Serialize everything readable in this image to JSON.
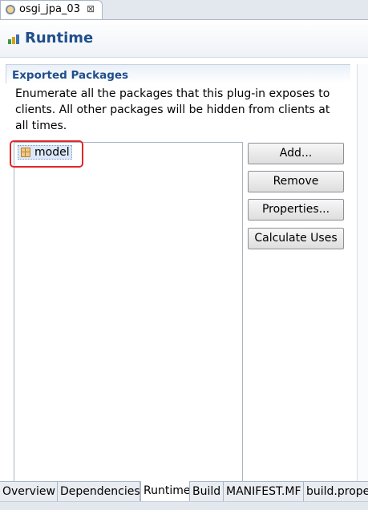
{
  "editor": {
    "tab_title": "osgi_jpa_03",
    "close_glyph": "⊠"
  },
  "page": {
    "title": "Runtime"
  },
  "section": {
    "title": "Exported Packages",
    "description": "Enumerate all the packages that this plug-in exposes to clients.  All other packages will be hidden from clients at all times."
  },
  "packages": [
    "model"
  ],
  "buttons": {
    "add": "Add...",
    "remove": "Remove",
    "properties": "Properties...",
    "calculate_uses": "Calculate Uses"
  },
  "bottom_tabs": [
    "Overview",
    "Dependencies",
    "Runtime",
    "Build",
    "MANIFEST.MF",
    "build.prope"
  ],
  "active_bottom_tab": "Runtime",
  "icons": {
    "editor_tab": "plugin-icon",
    "page": "runtime-icon",
    "package": "package-icon"
  },
  "colors": {
    "title": "#1f4e8c",
    "highlight": "#e0282b"
  }
}
